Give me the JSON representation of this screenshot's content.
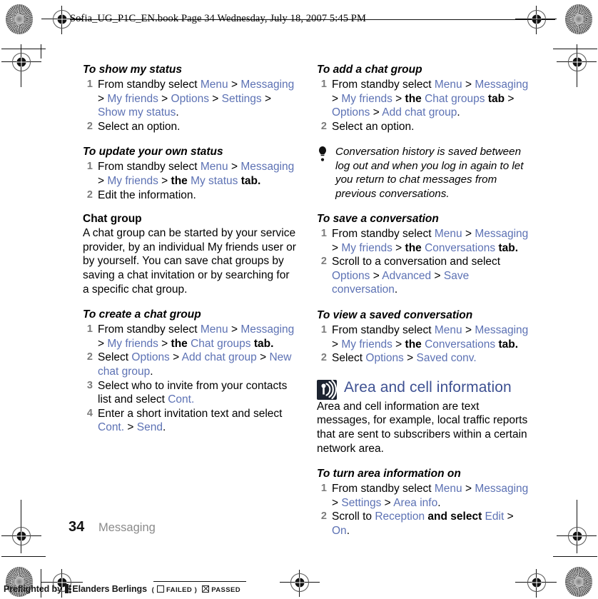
{
  "header": {
    "slug": "Sofia_UG_P1C_EN.book  Page 34  Wednesday, July 18, 2007  5:45 PM"
  },
  "footer": {
    "page_number": "34",
    "section": "Messaging",
    "preflight_prefix": "Preflighted by",
    "preflight_company": "Elanders Berlings",
    "preflight_failed_open": "(",
    "preflight_failed_label": "FAILED",
    "preflight_failed_close": ")",
    "preflight_passed_label": "PASSED"
  },
  "icons": {
    "area_chip": "broadcast-antenna-icon",
    "tip": "lightbulb-icon",
    "registration": "registration-target-icon",
    "color_bar": "starburst-target-icon"
  },
  "colors": {
    "link": "#5d72b4",
    "chapter_heading": "#3e5192",
    "step_number": "#7c7c7c",
    "section_footer": "#8a8a8a",
    "chip_background": "#1d2330"
  },
  "left_column": {
    "blocks": [
      {
        "type": "heading_italic",
        "id": "to-show-my-status",
        "text": "To show my status"
      },
      {
        "type": "steps",
        "id": "show-my-status-steps",
        "items": [
          {
            "num": "1",
            "runs": [
              {
                "t": "From standby select "
              },
              {
                "t": "Menu",
                "s": "lnk"
              },
              {
                "t": " > "
              },
              {
                "t": "Messaging",
                "s": "lnk"
              },
              {
                "t": " > "
              },
              {
                "t": "My friends",
                "s": "lnk"
              },
              {
                "t": " > "
              },
              {
                "t": "Options",
                "s": "lnk"
              },
              {
                "t": " > "
              },
              {
                "t": "Settings",
                "s": "lnk"
              },
              {
                "t": " > "
              },
              {
                "t": "Show my status",
                "s": "lnk"
              },
              {
                "t": "."
              }
            ]
          },
          {
            "num": "2",
            "runs": [
              {
                "t": "Select an option."
              }
            ]
          }
        ]
      },
      {
        "type": "heading_italic",
        "id": "to-update-your-own-status",
        "text": "To update your own status"
      },
      {
        "type": "steps",
        "id": "update-own-status-steps",
        "items": [
          {
            "num": "1",
            "runs": [
              {
                "t": "From standby select "
              },
              {
                "t": "Menu",
                "s": "lnk"
              },
              {
                "t": " > "
              },
              {
                "t": "Messaging",
                "s": "lnk"
              },
              {
                "t": " > "
              },
              {
                "t": "My friends",
                "s": "lnk"
              },
              {
                "t": " > "
              },
              {
                "t": "the ",
                "s": "b"
              },
              {
                "t": "My status",
                "s": "lnk"
              },
              {
                "t": " tab.",
                "s": "b"
              }
            ]
          },
          {
            "num": "2",
            "runs": [
              {
                "t": "Edit the information."
              }
            ]
          }
        ]
      },
      {
        "type": "heading_plain",
        "id": "chat-group",
        "text": "Chat group"
      },
      {
        "type": "paragraph",
        "id": "chat-group-description",
        "text": "A chat group can be started by your service provider, by an individual My friends user or by yourself. You can save chat groups by saving a chat invitation or by searching for a specific chat group."
      },
      {
        "type": "heading_italic",
        "id": "to-create-a-chat-group",
        "text": "To create a chat group"
      },
      {
        "type": "steps",
        "id": "create-chat-group-steps",
        "items": [
          {
            "num": "1",
            "runs": [
              {
                "t": "From standby select "
              },
              {
                "t": "Menu",
                "s": "lnk"
              },
              {
                "t": " > "
              },
              {
                "t": "Messaging",
                "s": "lnk"
              },
              {
                "t": " > "
              },
              {
                "t": "My friends",
                "s": "lnk"
              },
              {
                "t": " > "
              },
              {
                "t": "the ",
                "s": "b"
              },
              {
                "t": "Chat groups",
                "s": "lnk"
              },
              {
                "t": " tab.",
                "s": "b"
              }
            ]
          },
          {
            "num": "2",
            "runs": [
              {
                "t": "Select "
              },
              {
                "t": "Options",
                "s": "lnk"
              },
              {
                "t": " > "
              },
              {
                "t": "Add chat group",
                "s": "lnk"
              },
              {
                "t": " > "
              },
              {
                "t": "New chat group",
                "s": "lnk"
              },
              {
                "t": "."
              }
            ]
          },
          {
            "num": "3",
            "runs": [
              {
                "t": "Select who to invite from your contacts list and select "
              },
              {
                "t": "Cont.",
                "s": "lnk"
              }
            ]
          },
          {
            "num": "4",
            "runs": [
              {
                "t": "Enter a short invitation text and select "
              },
              {
                "t": "Cont.",
                "s": "lnk"
              },
              {
                "t": " > "
              },
              {
                "t": "Send",
                "s": "lnk"
              },
              {
                "t": "."
              }
            ]
          }
        ]
      }
    ]
  },
  "right_column": {
    "blocks": [
      {
        "type": "heading_italic",
        "id": "to-add-a-chat-group",
        "text": "To add a chat group"
      },
      {
        "type": "steps",
        "id": "add-chat-group-steps",
        "items": [
          {
            "num": "1",
            "runs": [
              {
                "t": "From standby select "
              },
              {
                "t": "Menu",
                "s": "lnk"
              },
              {
                "t": " > "
              },
              {
                "t": "Messaging",
                "s": "lnk"
              },
              {
                "t": " > "
              },
              {
                "t": "My friends",
                "s": "lnk"
              },
              {
                "t": " > "
              },
              {
                "t": "the ",
                "s": "b"
              },
              {
                "t": "Chat groups",
                "s": "lnk"
              },
              {
                "t": " tab",
                "s": "b"
              },
              {
                "t": " > "
              },
              {
                "t": "Options",
                "s": "lnk"
              },
              {
                "t": " > "
              },
              {
                "t": "Add chat group",
                "s": "lnk"
              },
              {
                "t": "."
              }
            ]
          },
          {
            "num": "2",
            "runs": [
              {
                "t": "Select an option."
              }
            ]
          }
        ]
      },
      {
        "type": "tip",
        "id": "conversation-history-tip",
        "text": "Conversation history is saved between log out and when you log in again to let you return to chat messages from previous conversations."
      },
      {
        "type": "heading_italic",
        "id": "to-save-a-conversation",
        "text": "To save a conversation"
      },
      {
        "type": "steps",
        "id": "save-conversation-steps",
        "items": [
          {
            "num": "1",
            "runs": [
              {
                "t": "From standby select "
              },
              {
                "t": "Menu",
                "s": "lnk"
              },
              {
                "t": " > "
              },
              {
                "t": "Messaging",
                "s": "lnk"
              },
              {
                "t": " > "
              },
              {
                "t": "My friends",
                "s": "lnk"
              },
              {
                "t": " > "
              },
              {
                "t": "the ",
                "s": "b"
              },
              {
                "t": "Conversations",
                "s": "lnk"
              },
              {
                "t": " tab.",
                "s": "b"
              }
            ]
          },
          {
            "num": "2",
            "runs": [
              {
                "t": "Scroll to a conversation and select "
              },
              {
                "t": "Options",
                "s": "lnk"
              },
              {
                "t": " > "
              },
              {
                "t": "Advanced",
                "s": "lnk"
              },
              {
                "t": " > "
              },
              {
                "t": "Save conversation",
                "s": "lnk"
              },
              {
                "t": "."
              }
            ]
          }
        ]
      },
      {
        "type": "heading_italic",
        "id": "to-view-a-saved-conversation",
        "text": "To view a saved conversation"
      },
      {
        "type": "steps",
        "id": "view-saved-conversation-steps",
        "items": [
          {
            "num": "1",
            "runs": [
              {
                "t": "From standby select "
              },
              {
                "t": "Menu",
                "s": "lnk"
              },
              {
                "t": " > "
              },
              {
                "t": "Messaging",
                "s": "lnk"
              },
              {
                "t": " > "
              },
              {
                "t": "My friends",
                "s": "lnk"
              },
              {
                "t": " > "
              },
              {
                "t": "the ",
                "s": "b"
              },
              {
                "t": "Conversations",
                "s": "lnk"
              },
              {
                "t": " tab.",
                "s": "b"
              }
            ]
          },
          {
            "num": "2",
            "runs": [
              {
                "t": "Select "
              },
              {
                "t": "Options",
                "s": "lnk"
              },
              {
                "t": " > "
              },
              {
                "t": "Saved conv.",
                "s": "lnk"
              }
            ]
          }
        ]
      },
      {
        "type": "chapter",
        "id": "area-and-cell-information",
        "text": "Area and cell information"
      },
      {
        "type": "paragraph",
        "id": "area-cell-description",
        "text": "Area and cell information are text messages, for example, local traffic reports that are sent to subscribers within a certain network area."
      },
      {
        "type": "heading_italic",
        "id": "to-turn-area-information-on",
        "text": "To turn area information on"
      },
      {
        "type": "steps",
        "id": "turn-area-info-on-steps",
        "items": [
          {
            "num": "1",
            "runs": [
              {
                "t": "From standby select "
              },
              {
                "t": "Menu",
                "s": "lnk"
              },
              {
                "t": " > "
              },
              {
                "t": "Messaging",
                "s": "lnk"
              },
              {
                "t": " > "
              },
              {
                "t": "Settings",
                "s": "lnk"
              },
              {
                "t": " > "
              },
              {
                "t": "Area info",
                "s": "lnk"
              },
              {
                "t": "."
              }
            ]
          },
          {
            "num": "2",
            "runs": [
              {
                "t": "Scroll to "
              },
              {
                "t": "Reception",
                "s": "lnk"
              },
              {
                "t": " and select ",
                "s": "b"
              },
              {
                "t": "Edit",
                "s": "lnk"
              },
              {
                "t": " > "
              },
              {
                "t": "On",
                "s": "lnk"
              },
              {
                "t": "."
              }
            ]
          }
        ]
      }
    ]
  }
}
